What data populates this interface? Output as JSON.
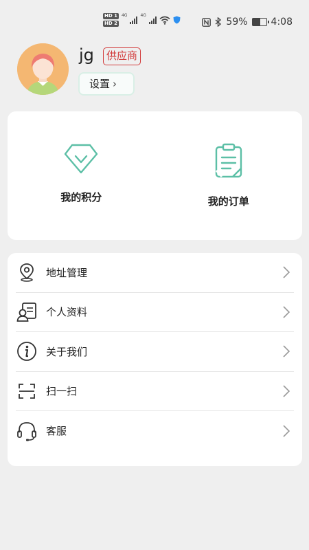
{
  "status_bar": {
    "net1": "4G",
    "net2": "4G",
    "battery": "59%",
    "battery_level": 0.59,
    "time": "4:08",
    "icons": [
      "hd-icon",
      "signal-icon",
      "wifi-icon",
      "shield-icon",
      "nfc-icon",
      "bluetooth-icon",
      "battery-icon"
    ]
  },
  "profile": {
    "username": "jg",
    "badge": "供应商",
    "settings_label": "设置",
    "settings_chevron": "›"
  },
  "quick_actions": [
    {
      "label": "我的积分",
      "icon": "diamond-icon"
    },
    {
      "label": "我的订单",
      "icon": "order-clipboard-icon"
    }
  ],
  "menu": [
    {
      "label": "地址管理",
      "icon": "location-pin-icon"
    },
    {
      "label": "个人资料",
      "icon": "profile-card-icon"
    },
    {
      "label": "关于我们",
      "icon": "info-icon"
    },
    {
      "label": "扫一扫",
      "icon": "scan-icon"
    },
    {
      "label": "客服",
      "icon": "headset-icon"
    }
  ],
  "colors": {
    "accent": "#5cbfa6",
    "badge_red": "#d23b3b",
    "avatar_bg": "#f4b772",
    "page_bg": "#efefef"
  }
}
